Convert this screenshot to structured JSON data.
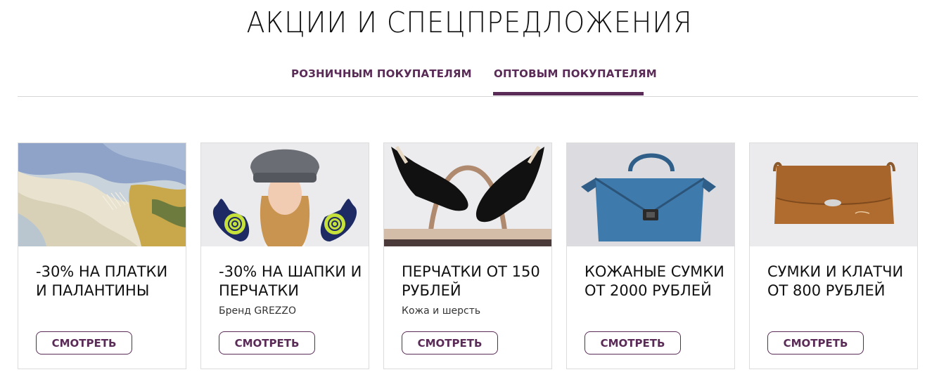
{
  "page": {
    "title": "АКЦИИ И СПЕЦПРЕДЛОЖЕНИЯ"
  },
  "tabs": [
    {
      "label": "РОЗНИЧНЫМ ПОКУПАТЕЛЯМ",
      "active": false
    },
    {
      "label": "ОПТОВЫМ ПОКУПАТЕЛЯМ",
      "active": true
    }
  ],
  "colors": {
    "accent": "#5a2b57",
    "divider": "#d6d6d6",
    "card_border": "#dcdcdc"
  },
  "offers": [
    {
      "title": "-30% НА ПЛАТКИ И ПАЛАНТИНЫ",
      "subtitle": "",
      "button": "СМОТРЕТЬ",
      "image": "scarves-photo"
    },
    {
      "title": "-30% НА ШАПКИ И ПЕРЧАТКИ",
      "subtitle": "Бренд GREZZO",
      "button": "СМОТРЕТЬ",
      "image": "girl-in-hat-and-gloves-photo"
    },
    {
      "title": "ПЕРЧАТКИ ОТ 150 РУБЛЕЙ",
      "subtitle": "Кожа и шерсть",
      "button": "СМОТРЕТЬ",
      "image": "leather-gloves-photo"
    },
    {
      "title": "КОЖАНЫЕ СУМКИ ОТ 2000 РУБЛЕЙ",
      "subtitle": "",
      "button": "СМОТРЕТЬ",
      "image": "blue-leather-bag-photo"
    },
    {
      "title": "СУМКИ И КЛАТЧИ ОТ 800 РУБЛЕЙ",
      "subtitle": "",
      "button": "СМОТРЕТЬ",
      "image": "brown-bag-photo"
    }
  ]
}
